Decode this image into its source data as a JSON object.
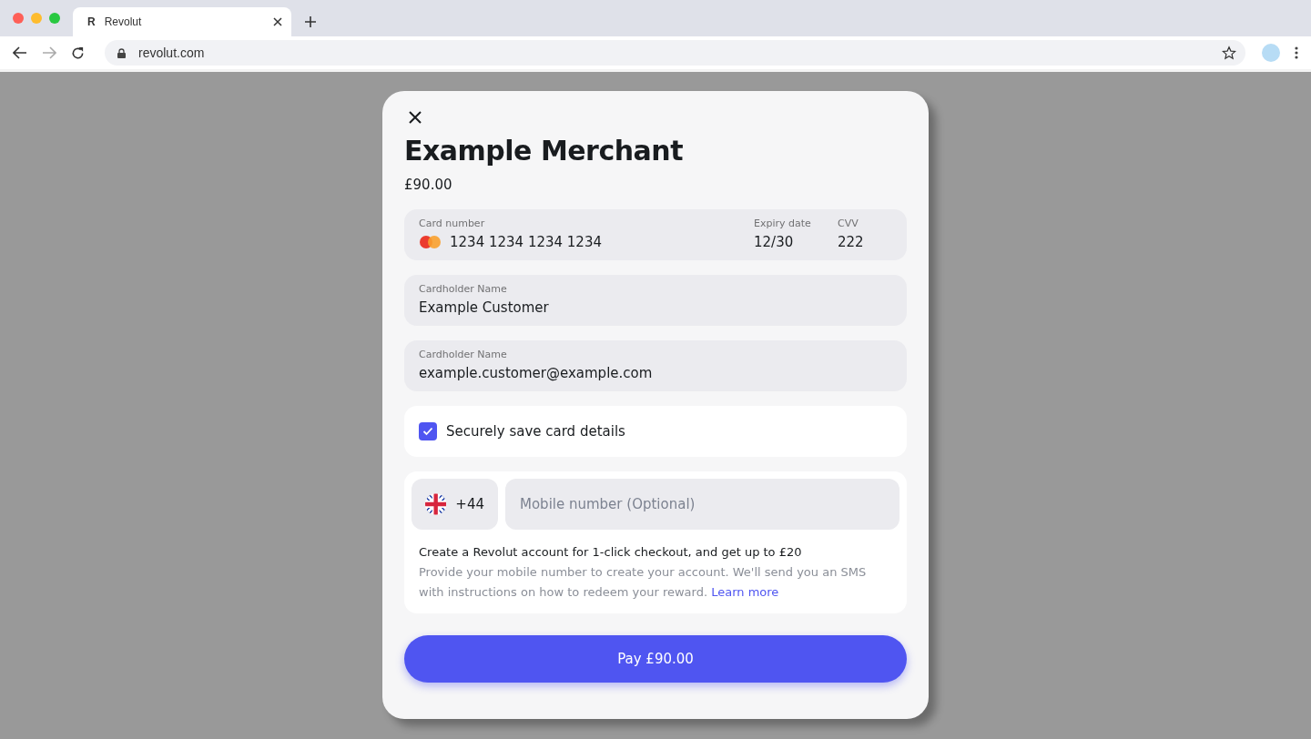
{
  "browser": {
    "tab": {
      "icon_text": "R",
      "title": "Revolut"
    },
    "url": "revolut.com"
  },
  "modal": {
    "merchant": "Example Merchant",
    "amount": "£90.00",
    "card": {
      "number_label": "Card number",
      "number": "1234 1234 1234 1234",
      "expiry_label": "Expiry date",
      "expiry": "12/30",
      "cvv_label": "CVV",
      "cvv": "222"
    },
    "fields": [
      {
        "label": "Cardholder Name",
        "value": "Example Customer"
      },
      {
        "label": "Cardholder Name",
        "value": "example.customer@example.com"
      }
    ],
    "save_card": {
      "label": "Securely save card details",
      "checked": true
    },
    "phone": {
      "code": "+44",
      "placeholder": "Mobile number (Optional)",
      "headline": "Create a Revolut account for 1-click checkout, and get up to £20",
      "description": "Provide your mobile number to create your account. We'll send you an SMS with instructions on how to redeem your reward.",
      "link": "Learn more"
    },
    "pay_button": "Pay £90.00"
  }
}
